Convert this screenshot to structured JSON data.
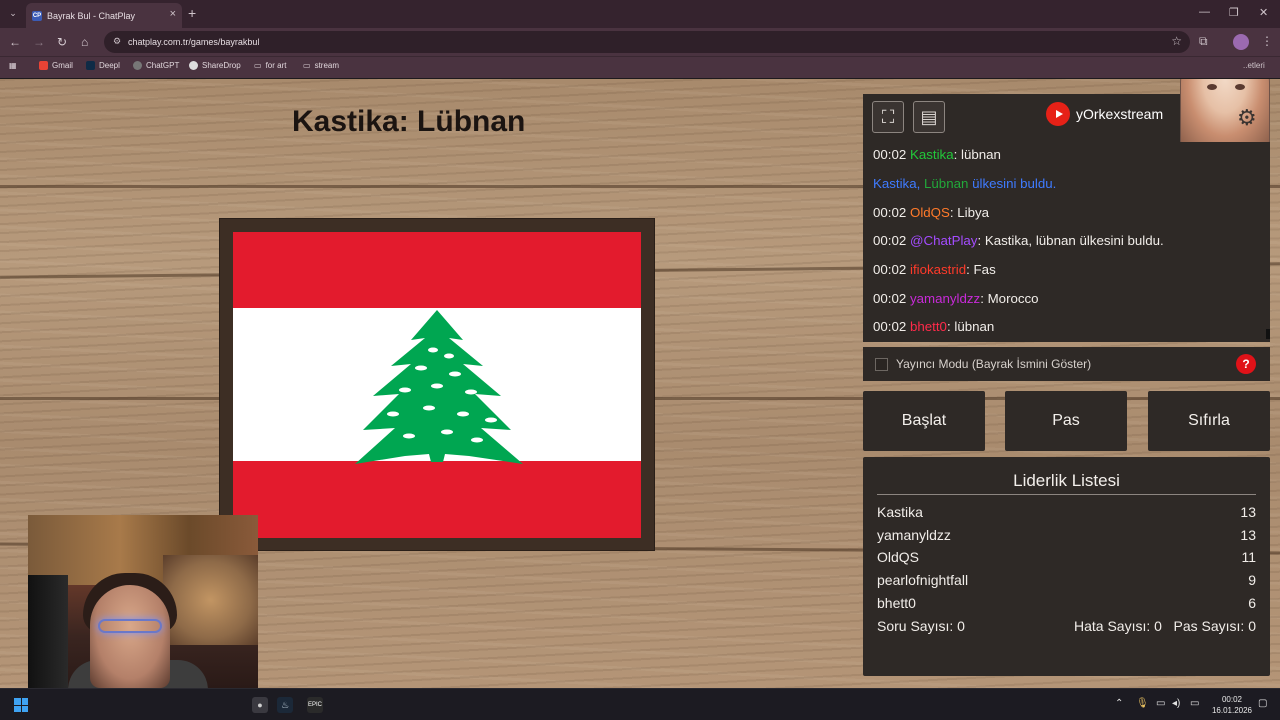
{
  "browser": {
    "tab_title": "Bayrak Bul - ChatPlay",
    "tab_favicon": "CP",
    "url": "chatplay.com.tr/games/bayrakbul",
    "bookmarks": [
      {
        "label": "Gmail",
        "color": "#ea4335"
      },
      {
        "label": "Deepl",
        "color": "#0f2b46"
      },
      {
        "label": "ChatGPT",
        "color": "#777777"
      },
      {
        "label": "ShareDrop",
        "color": "#dddddd"
      },
      {
        "label": "for art",
        "color": "folder"
      },
      {
        "label": "stream",
        "color": "folder"
      }
    ],
    "bookmarks_overflow": "..etleri"
  },
  "game": {
    "title": "Kastika: Lübnan",
    "flag": "lebanon-flag",
    "flag_colors": {
      "red": "#e31b2d",
      "white": "#ffffff",
      "cedar": "#00a651"
    }
  },
  "stream": {
    "youtube_channel": "yOrkexstream"
  },
  "chat": {
    "messages": [
      {
        "time": "00:02",
        "user": "Kastika",
        "user_color": "#22c83a",
        "sep": ": ",
        "text": "lübnan"
      },
      {
        "time": "",
        "user": "Kastika,",
        "user_color": "#3f7bff",
        "sep": " ",
        "text": "ülkesini buldu.",
        "mid": "Lübnan",
        "mid_color": "#22a83a",
        "text_color": "#3f7bff"
      },
      {
        "time": "00:02",
        "user": "OldQS",
        "user_color": "#ff7a2a",
        "sep": ": ",
        "text": "Libya"
      },
      {
        "time": "00:02",
        "user": "@ChatPlay",
        "user_color": "#a44cff",
        "sep": ": ",
        "text": "Kastika, lübnan ülkesini buldu."
      },
      {
        "time": "00:02",
        "user": "ifiokastrid",
        "user_color": "#ff3a2a",
        "sep": ": ",
        "text": "Fas"
      },
      {
        "time": "00:02",
        "user": "yamanyldzz",
        "user_color": "#c82ad8",
        "sep": ": ",
        "text": "Morocco"
      },
      {
        "time": "00:02",
        "user": "bhett0",
        "user_color": "#ff2a4a",
        "sep": ": ",
        "text": "lübnan"
      }
    ]
  },
  "controls": {
    "streamer_mode_label": "Yayıncı Modu (Bayrak İsmini Göster)",
    "streamer_mode_checked": false,
    "help_label": "?",
    "start_label": "Başlat",
    "pass_label": "Pas",
    "reset_label": "Sıfırla"
  },
  "leaderboard": {
    "title": "Liderlik Listesi",
    "rows": [
      {
        "name": "Kastika",
        "score": "13"
      },
      {
        "name": "yamanyldzz",
        "score": "13"
      },
      {
        "name": "OldQS",
        "score": "11"
      },
      {
        "name": "pearlofnightfall",
        "score": "9"
      },
      {
        "name": "bhett0",
        "score": "6"
      }
    ],
    "questions": "Soru Sayısı: 0",
    "errors": "Hata Sayısı: 0",
    "passes": "Pas Sayısı: 0"
  },
  "taskbar": {
    "time": "00:02",
    "date": "16.01.2026"
  }
}
